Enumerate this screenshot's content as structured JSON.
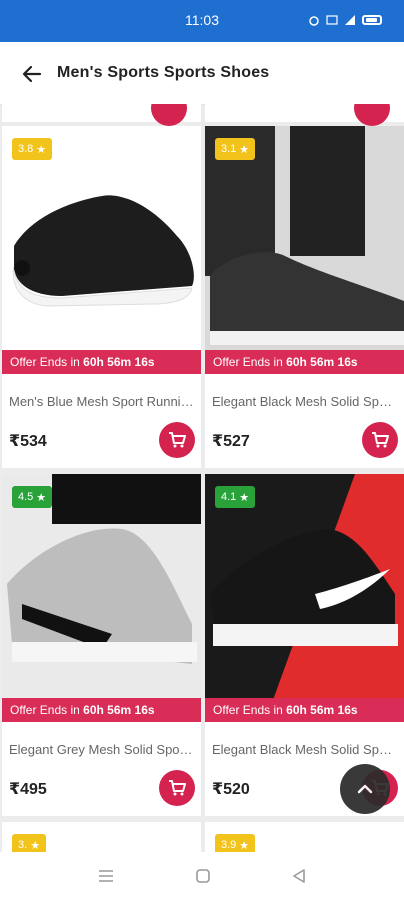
{
  "status_bar": {
    "time": "11:03"
  },
  "app_bar": {
    "title": "Men's Sports Sports Shoes"
  },
  "products": [
    {
      "rating": "3.8",
      "name": "Men's Blue Mesh Sport Running Shoes",
      "price": "₹534",
      "offer_prefix": "Offer Ends in",
      "offer_time": "60h 56m 16s",
      "badge_color": "#f2c31a"
    },
    {
      "rating": "3.1",
      "name": "Elegant Black Mesh Solid Sports Shoes",
      "price": "₹527",
      "offer_prefix": "Offer Ends in",
      "offer_time": "60h 56m 16s",
      "badge_color": "#f2c31a"
    },
    {
      "rating": "4.5",
      "name": "Elegant Grey Mesh Solid Sports Shoes",
      "price": "₹495",
      "offer_prefix": "Offer Ends in",
      "offer_time": "60h 56m 16s",
      "badge_color": "#2aa23a"
    },
    {
      "rating": "4.1",
      "name": "Elegant Black Mesh Solid Sports Shoes",
      "price": "₹520",
      "offer_prefix": "Offer Ends in",
      "offer_time": "60h 56m 16s",
      "badge_color": "#2aa23a"
    }
  ],
  "partial_products": [
    {
      "rating": "3."
    },
    {
      "rating": "3.9"
    }
  ],
  "colors": {
    "status_bar": "#1e6fd0",
    "accent": "#d4234f",
    "offer_banner": "#d92c56"
  }
}
